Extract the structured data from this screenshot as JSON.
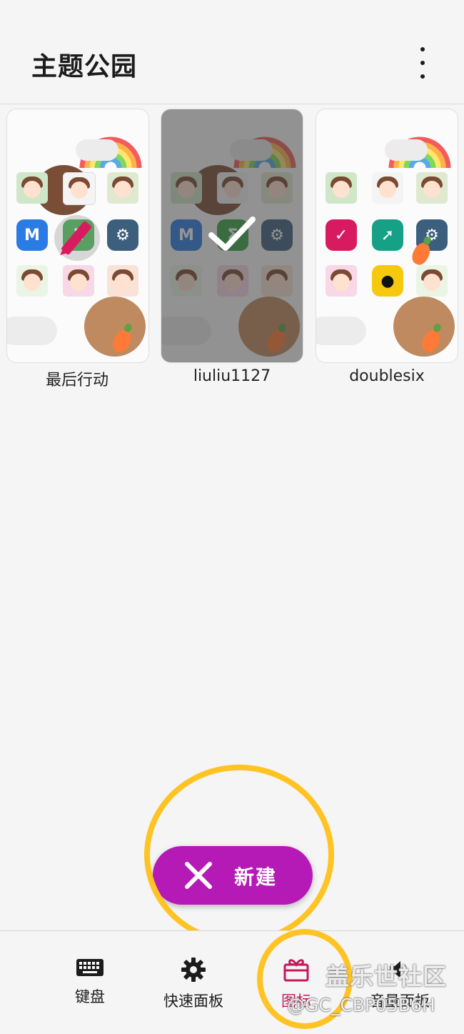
{
  "appbar": {
    "title": "主题公园",
    "more_icon": "more-vert-icon"
  },
  "themes": [
    {
      "label": "最后行动",
      "state": "editable",
      "overlay_icon": "pencil-icon"
    },
    {
      "label": "liuliu1127",
      "state": "selected",
      "overlay_icon": "check-icon"
    },
    {
      "label": "doublesix",
      "state": "normal"
    }
  ],
  "fab": {
    "label": "新建",
    "icon": "tools-icon",
    "color": "#b51ab7"
  },
  "bottom_nav": [
    {
      "label": "键盘",
      "icon": "keyboard-icon"
    },
    {
      "label": "快速面板",
      "icon": "gear-icon"
    },
    {
      "label": "图标",
      "icon": "gift-icon",
      "active": true
    },
    {
      "label": "音量面板",
      "icon": "volume-icon"
    }
  ],
  "watermark": {
    "line1": "盖乐世社区",
    "line2": "@GC_CBP05B6H"
  },
  "colors": {
    "accent": "#b51ab7",
    "active_nav": "#c2185b",
    "highlight_ring": "#ffc323"
  }
}
